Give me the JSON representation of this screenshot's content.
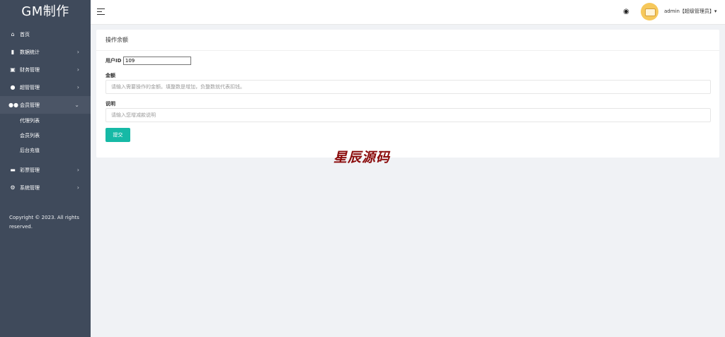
{
  "app": {
    "logo": "GM制作",
    "copyright": "Copyright © 2023. All rights reserved."
  },
  "sidebar": {
    "items": [
      {
        "icon": "home-icon",
        "label": "首页",
        "has_arrow": false
      },
      {
        "icon": "bar-chart-icon",
        "label": "数据统计",
        "has_arrow": true
      },
      {
        "icon": "bank-icon",
        "label": "财务管理",
        "has_arrow": true
      },
      {
        "icon": "user-icon",
        "label": "超管管理",
        "has_arrow": true
      },
      {
        "icon": "users-icon",
        "label": "会员管理",
        "has_arrow": true,
        "expanded": true
      },
      {
        "icon": "gamepad-icon",
        "label": "彩票管理",
        "has_arrow": true
      },
      {
        "icon": "gear-icon",
        "label": "系统管理",
        "has_arrow": true
      }
    ],
    "submenu": [
      "代理列表",
      "会员列表",
      "后台充值"
    ],
    "arrow_collapsed": "›",
    "arrow_expanded": "⌄"
  },
  "topbar": {
    "username": "admin【超级管理员】▾"
  },
  "card": {
    "title": "操作余额",
    "user_id_label": "用户ID",
    "user_id_value": "109",
    "amount_label": "金额",
    "amount_placeholder": "请输入需要操作的金额。填整数是增加，负整数就代表扣钱。",
    "note_label": "说明",
    "note_placeholder": "请输入您增减款说明",
    "submit_label": "提交"
  },
  "watermark": "星辰源码",
  "colors": {
    "sidebar_bg": "#3f4a5b",
    "accent": "#16b9a6",
    "watermark": "#8b0d0d"
  }
}
